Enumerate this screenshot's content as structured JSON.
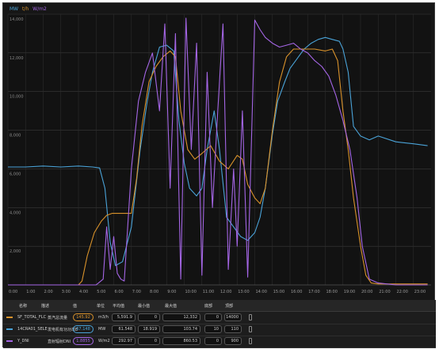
{
  "legend_top": [
    {
      "label": "MW",
      "color": "#4aa3d8"
    },
    {
      "label": "t/h",
      "color": "#d9922b"
    },
    {
      "label": "W/m2",
      "color": "#a566e6"
    }
  ],
  "chart_data": {
    "type": "line",
    "x_ticks": [
      "0:00",
      "1:00",
      "2:00",
      "3:00",
      "4:00",
      "5:00",
      "6:00",
      "7:00",
      "8:00",
      "9:00",
      "10:00",
      "11:00",
      "12:00",
      "13:00",
      "14:00",
      "15:00",
      "16:00",
      "17:00",
      "18:00",
      "19:00",
      "20:00",
      "21:00",
      "22:00",
      "23:00"
    ],
    "y_ticks": [
      "2,000",
      "4,000",
      "6,000",
      "8,000",
      "10,000",
      "12,000",
      "14,000"
    ],
    "xlim": [
      0,
      24
    ],
    "ylim": [
      0,
      14000
    ],
    "grid": true,
    "series": [
      {
        "name": "MW",
        "color": "#4aa3d8",
        "x": [
          0,
          1,
          2,
          3,
          4,
          4.8,
          5.2,
          5.5,
          5.8,
          6.1,
          6.5,
          7.0,
          7.5,
          7.9,
          8.2,
          8.6,
          9.0,
          9.4,
          9.7,
          10.0,
          10.3,
          10.7,
          11.0,
          11.3,
          11.7,
          12.0,
          12.4,
          12.8,
          13.2,
          13.6,
          14.0,
          14.3,
          14.6,
          15.0,
          15.3,
          15.7,
          16.0,
          16.4,
          16.8,
          17.2,
          17.6,
          18.0,
          18.4,
          18.8,
          19.0,
          19.3,
          19.6,
          20.0,
          20.5,
          21.0,
          22.0,
          23.0,
          23.8
        ],
        "y": [
          6100,
          6100,
          6150,
          6100,
          6150,
          6100,
          6050,
          5000,
          2200,
          1000,
          1200,
          3000,
          7000,
          9500,
          11000,
          12300,
          12400,
          12100,
          8500,
          6300,
          5000,
          4600,
          5000,
          7000,
          9000,
          7000,
          3500,
          3000,
          2500,
          2300,
          2700,
          3500,
          5000,
          7800,
          9500,
          10500,
          11200,
          11700,
          12200,
          12500,
          12700,
          12800,
          12700,
          12600,
          12200,
          11000,
          8200,
          7700,
          7500,
          7700,
          7400,
          7300,
          7200
        ]
      },
      {
        "name": "t/h",
        "color": "#d9922b",
        "x": [
          0,
          1,
          2,
          3,
          4,
          4.2,
          4.5,
          4.9,
          5.3,
          5.6,
          5.9,
          6.5,
          7.0,
          7.3,
          7.6,
          8.0,
          8.4,
          8.8,
          9.2,
          9.5,
          9.8,
          10.2,
          10.6,
          11.0,
          11.5,
          12.0,
          12.5,
          13.0,
          13.3,
          13.6,
          14.0,
          14.3,
          14.6,
          15.0,
          15.4,
          15.8,
          16.2,
          16.8,
          17.4,
          18.0,
          18.4,
          18.7,
          19.0,
          19.3,
          19.6,
          20.0,
          20.3,
          20.6,
          21.0,
          22.0,
          23.0,
          23.8
        ],
        "y": [
          0,
          0,
          0,
          0,
          0,
          200,
          1500,
          2700,
          3300,
          3600,
          3700,
          3700,
          3700,
          5500,
          8200,
          10500,
          11300,
          11800,
          12100,
          11800,
          9000,
          7000,
          6500,
          6800,
          7200,
          6400,
          6000,
          6700,
          6500,
          5200,
          4500,
          4200,
          5000,
          8000,
          10500,
          11800,
          12200,
          12200,
          12200,
          12100,
          12200,
          11600,
          9000,
          7000,
          4500,
          2000,
          500,
          100,
          50,
          50,
          50,
          50
        ]
      },
      {
        "name": "W/m2",
        "color": "#a566e6",
        "x": [
          0,
          1,
          2,
          3,
          4,
          5,
          5.4,
          5.6,
          5.8,
          6.0,
          6.2,
          6.4,
          6.6,
          7.0,
          7.4,
          7.8,
          8.2,
          8.6,
          8.9,
          9.2,
          9.5,
          9.8,
          10.1,
          10.4,
          10.7,
          11.0,
          11.3,
          11.6,
          11.9,
          12.2,
          12.5,
          12.8,
          13.0,
          13.3,
          13.6,
          14.0,
          14.3,
          14.6,
          15.0,
          15.4,
          15.8,
          16.2,
          16.6,
          17.0,
          17.4,
          17.8,
          18.2,
          18.6,
          19.0,
          19.4,
          19.8,
          20.1,
          20.5,
          21.0,
          22.0,
          23.0,
          23.8
        ],
        "y": [
          0,
          0,
          0,
          0,
          0,
          0,
          300,
          3000,
          800,
          2500,
          600,
          300,
          200,
          6000,
          9500,
          11000,
          12000,
          9000,
          13500,
          5000,
          13000,
          300,
          13800,
          7000,
          12500,
          500,
          11000,
          4000,
          9000,
          13500,
          800,
          6000,
          2000,
          9000,
          400,
          13700,
          13200,
          12800,
          12500,
          12300,
          12400,
          12500,
          12200,
          12000,
          11600,
          11300,
          10800,
          9800,
          8500,
          7000,
          4500,
          2000,
          300,
          100,
          0,
          0,
          0
        ]
      }
    ]
  },
  "table": {
    "headers": {
      "name": "名称",
      "desc": "描述",
      "value": "值",
      "unit": "单位",
      "avg": "平均值",
      "min": "最小值",
      "max": "最大值",
      "low": "底部",
      "high": "顶部"
    },
    "rows": [
      {
        "name": "SF_TOTAL_FLC",
        "desc": "蒸汽总流量",
        "value": "145.92",
        "unit": "m3/h",
        "avg": "5,591.9",
        "min": "0",
        "max": "12,332",
        "low": "0",
        "high": "14000",
        "color": "#d9922b"
      },
      {
        "name": "14CRA01_SELE",
        "desc": "发电机有功功率E",
        "value": "67.148",
        "unit": "MW",
        "avg": "61.548",
        "min": "18.919",
        "max": "103.74",
        "low": "10",
        "high": "110",
        "color": "#4aa3d8"
      },
      {
        "name": "Y_DNI",
        "desc": "直射辐射DNI",
        "value": "1.8855",
        "unit": "W/m2",
        "avg": "292.97",
        "min": "0",
        "max": "860.53",
        "low": "0",
        "high": "900",
        "color": "#a566e6"
      }
    ]
  }
}
